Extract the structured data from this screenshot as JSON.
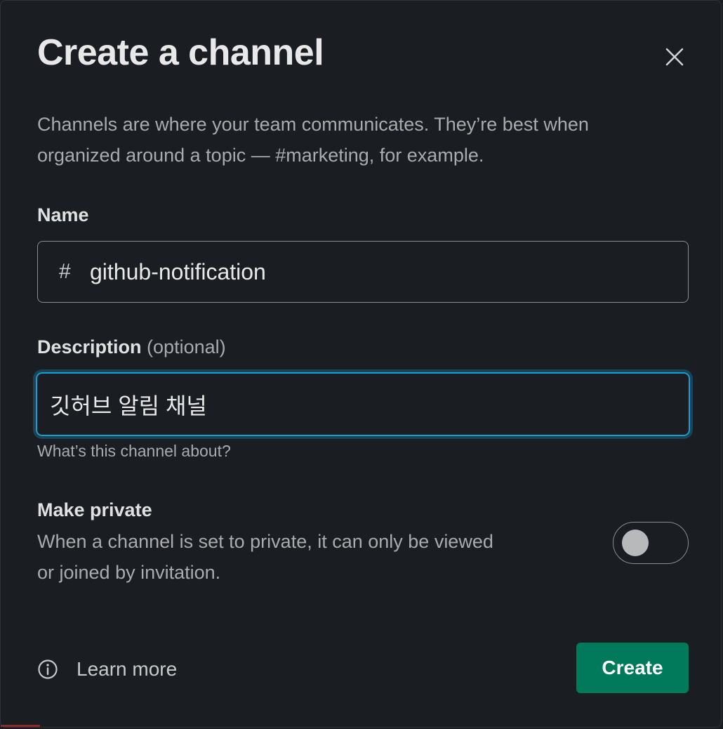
{
  "dialog": {
    "title": "Create a channel",
    "intro": "Channels are where your team communicates. They’re best when organized around a topic — #marketing, for example.",
    "close_icon": "close-icon"
  },
  "name_field": {
    "label": "Name",
    "prefix": "#",
    "value": "github-notification"
  },
  "description_field": {
    "label": "Description",
    "optional_text": "(optional)",
    "value": "깃허브 알림 채널",
    "helper": "What’s this channel about?"
  },
  "private_setting": {
    "label": "Make private",
    "description": "When a channel is set to private, it can only be viewed or joined by invitation.",
    "enabled": false
  },
  "footer": {
    "learn_more_icon": "info-icon",
    "learn_more_label": "Learn more",
    "create_label": "Create"
  },
  "colors": {
    "background": "#1a1d21",
    "focus_ring": "#1d9bd1",
    "primary_button": "#007a5a"
  }
}
